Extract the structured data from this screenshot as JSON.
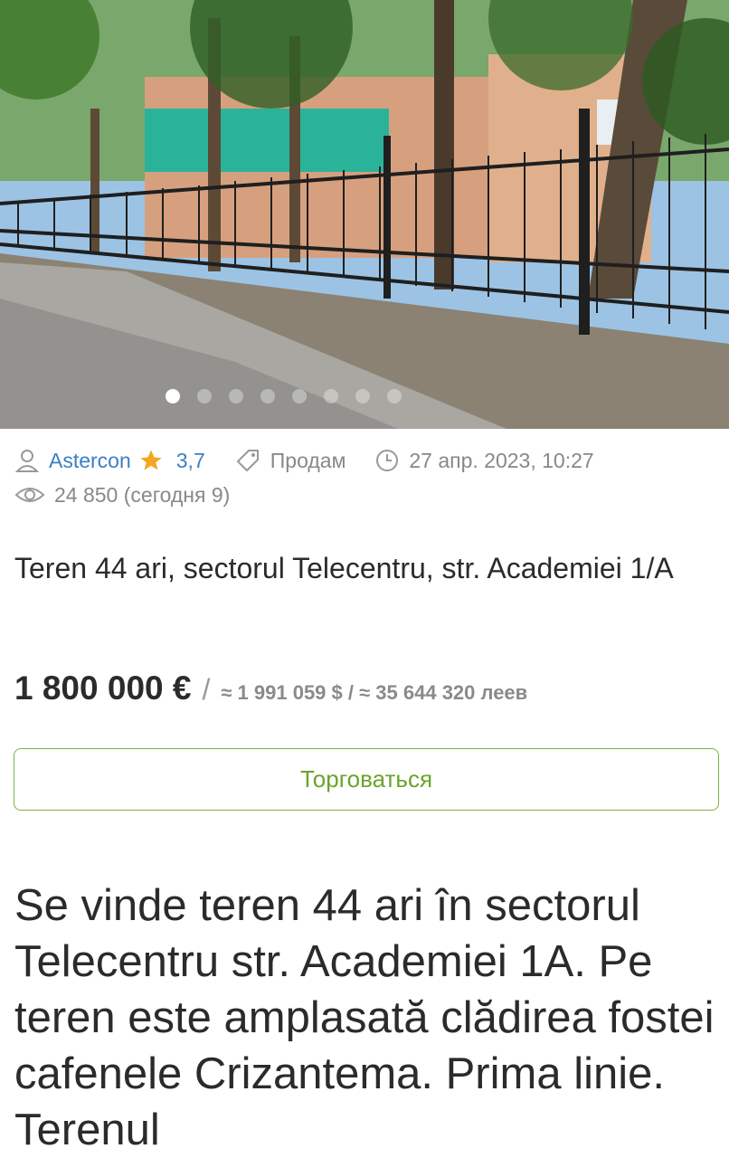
{
  "gallery": {
    "photo_label": "Listing photo",
    "slide_count": 8,
    "active_slide": 1
  },
  "meta": {
    "user_name": "Astercon",
    "rating": "3,7",
    "ad_type": "Продам",
    "date": "27 апр. 2023, 10:27",
    "views": "24 850 (сегодня 9)"
  },
  "listing": {
    "title": "Teren 44 ari, sectorul Telecentru, str. Academiei 1/A",
    "price_main": "1 800 000 €",
    "price_separator": "/",
    "price_alt": "≈ 1 991 059 $ / ≈ 35 644 320 леев",
    "bargain_label": "Торговаться",
    "description": "Se vinde teren 44 ari în sectorul Telecentru str. Academiei 1A. Pe teren este amplasată clădirea fostei cafenele Crizantema. Prima linie. Terenul"
  },
  "colors": {
    "link": "#3b7fc4",
    "star": "#f5a623",
    "accent_green": "#7cb342"
  }
}
